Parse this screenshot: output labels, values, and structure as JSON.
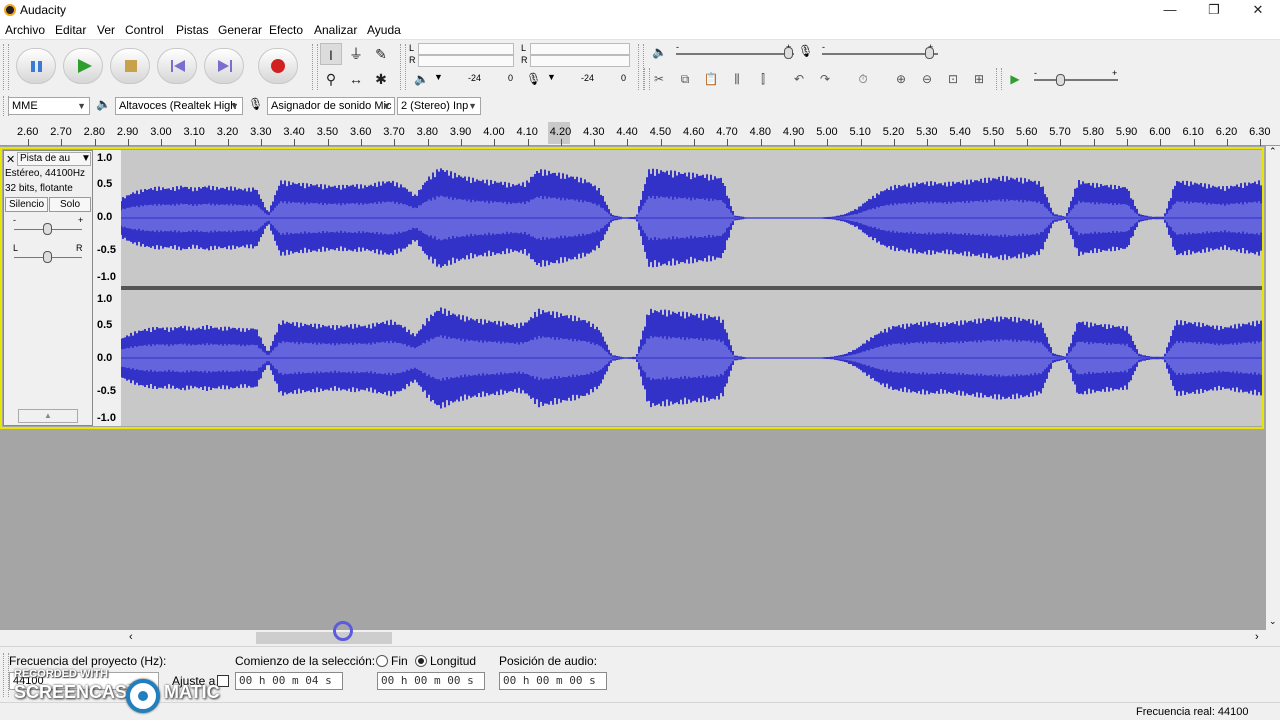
{
  "window": {
    "title": "Audacity",
    "minimize": "—",
    "restore": "❐",
    "close": "✕"
  },
  "menu": [
    "Archivo",
    "Editar",
    "Ver",
    "Control",
    "Pistas",
    "Generar",
    "Efecto",
    "Analizar",
    "Ayuda"
  ],
  "transport": {
    "pause": "pause-icon",
    "play": "play-icon",
    "stop": "stop-icon",
    "skip_start": "skip-start-icon",
    "skip_end": "skip-end-icon",
    "record": "record-icon"
  },
  "tools": [
    "selection-tool-icon",
    "envelope-tool-icon",
    "draw-tool-icon",
    "zoom-tool-icon",
    "timeshift-tool-icon",
    "multi-tool-icon"
  ],
  "meters": {
    "rec_L": "L",
    "rec_R": "R",
    "play_L": "L",
    "play_R": "R",
    "scale_a_left": "-24",
    "scale_a_right": "0",
    "scale_b_left": "-24",
    "scale_b_right": "0"
  },
  "mixer": {
    "minus1": "-",
    "plus1": "+",
    "minus2": "-",
    "plus2": "+",
    "minus3": "-",
    "plus3": "+"
  },
  "devices": {
    "host": "MME",
    "output": "Altavoces (Realtek High",
    "input": "Asignador de sonido Mic",
    "channels": "2 (Stereo) Inp"
  },
  "ruler_ticks": [
    "2.60",
    "2.70",
    "2.80",
    "2.90",
    "3.00",
    "3.10",
    "3.20",
    "3.30",
    "3.40",
    "3.50",
    "3.60",
    "3.70",
    "3.80",
    "3.90",
    "4.00",
    "4.10",
    "4.20",
    "4.30",
    "4.40",
    "4.50",
    "4.60",
    "4.70",
    "4.80",
    "4.90",
    "5.00",
    "5.10",
    "5.20",
    "5.30",
    "5.40",
    "5.50",
    "5.60",
    "5.70",
    "5.80",
    "5.90",
    "6.00",
    "6.10",
    "6.20",
    "6.30"
  ],
  "track": {
    "close": "✕",
    "name": "Pista de au",
    "info1": "Estéreo, 44100Hz",
    "info2": "32 bits, flotante",
    "mute": "Silencio",
    "solo": "Solo",
    "gain_minus": "-",
    "gain_plus": "+",
    "pan_left": "L",
    "pan_right": "R",
    "collapse": "▲",
    "scale": [
      "1.0",
      "0.5",
      "0.0",
      "-0.5",
      "-1.0"
    ]
  },
  "wave_envelope": [
    0.3,
    0.4,
    0.45,
    0.48,
    0.46,
    0.5,
    0.46,
    0.5,
    0.47,
    0.48,
    0.45,
    0.47,
    0.08,
    0.58,
    0.55,
    0.53,
    0.52,
    0.5,
    0.5,
    0.52,
    0.5,
    0.55,
    0.58,
    0.5,
    0.35,
    0.62,
    0.78,
    0.7,
    0.64,
    0.6,
    0.58,
    0.56,
    0.52,
    0.55,
    0.75,
    0.72,
    0.68,
    0.64,
    0.58,
    0.45,
    0.05,
    0.01,
    0.02,
    0.75,
    0.74,
    0.72,
    0.7,
    0.68,
    0.66,
    0.62,
    0.04,
    0.01,
    0.01,
    0.01,
    0.01,
    0.01,
    0.01,
    0.01,
    0.02,
    0.06,
    0.15,
    0.3,
    0.42,
    0.5,
    0.52,
    0.55,
    0.56,
    0.54,
    0.56,
    0.58,
    0.6,
    0.62,
    0.64,
    0.62,
    0.6,
    0.55,
    0.07,
    0.02,
    0.58,
    0.54,
    0.52,
    0.5,
    0.48,
    0.06,
    0.02,
    0.02,
    0.58,
    0.56,
    0.54,
    0.5,
    0.48,
    0.52,
    0.55,
    0.58
  ],
  "selection": {
    "project_rate_label": "Frecuencia del proyecto (Hz):",
    "project_rate": "44100",
    "snap_label": "Ajuste a",
    "start_label": "Comienzo de la selección:",
    "end_label": "Fin",
    "length_label": "Longitud",
    "audio_pos_label": "Posición de audio:",
    "start_time": "00 h 00 m 04 s",
    "length_time": "00 h 00 m 00 s",
    "audio_time": "00 h 00 m 00 s"
  },
  "status": {
    "actual_rate": "Frecuencia real: 44100"
  },
  "watermark": {
    "line1": "RECORDED WITH",
    "line2a": "SCREENCAST",
    "line2b": "MATIC"
  },
  "colors": {
    "wave": "#3232c8",
    "wave_rms": "#6464dc",
    "track_bg": "#c8c8c8",
    "selection_border": "#e6e600"
  }
}
